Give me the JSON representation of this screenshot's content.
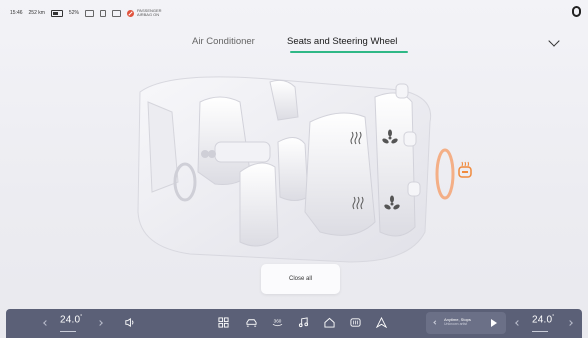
{
  "status_bar": {
    "time": "15:46",
    "range": "252 km",
    "battery": "52%",
    "airbag_line1": "PASSENGER",
    "airbag_line2": "AIRBAG ON"
  },
  "tabs": [
    {
      "label": "Air Conditioner",
      "active": false
    },
    {
      "label": "Seats and Steering Wheel",
      "active": true
    }
  ],
  "colors": {
    "accent": "#2fb886",
    "heat_highlight": "#f08a3c",
    "dock": "#5b6077"
  },
  "main": {
    "close_all_label": "Close all"
  },
  "dock": {
    "left_temp": "24.0",
    "right_temp": "24.0",
    "temp_unit": "°",
    "icons": [
      "volume-icon",
      "apps-icon",
      "car-icon",
      "360-view-icon",
      "music-icon",
      "home-icon",
      "defrost-icon",
      "navigation-icon"
    ],
    "icon_360_label": "360",
    "media": {
      "title": "Anytime, Stops",
      "subtitle": "Unknown artist"
    }
  }
}
